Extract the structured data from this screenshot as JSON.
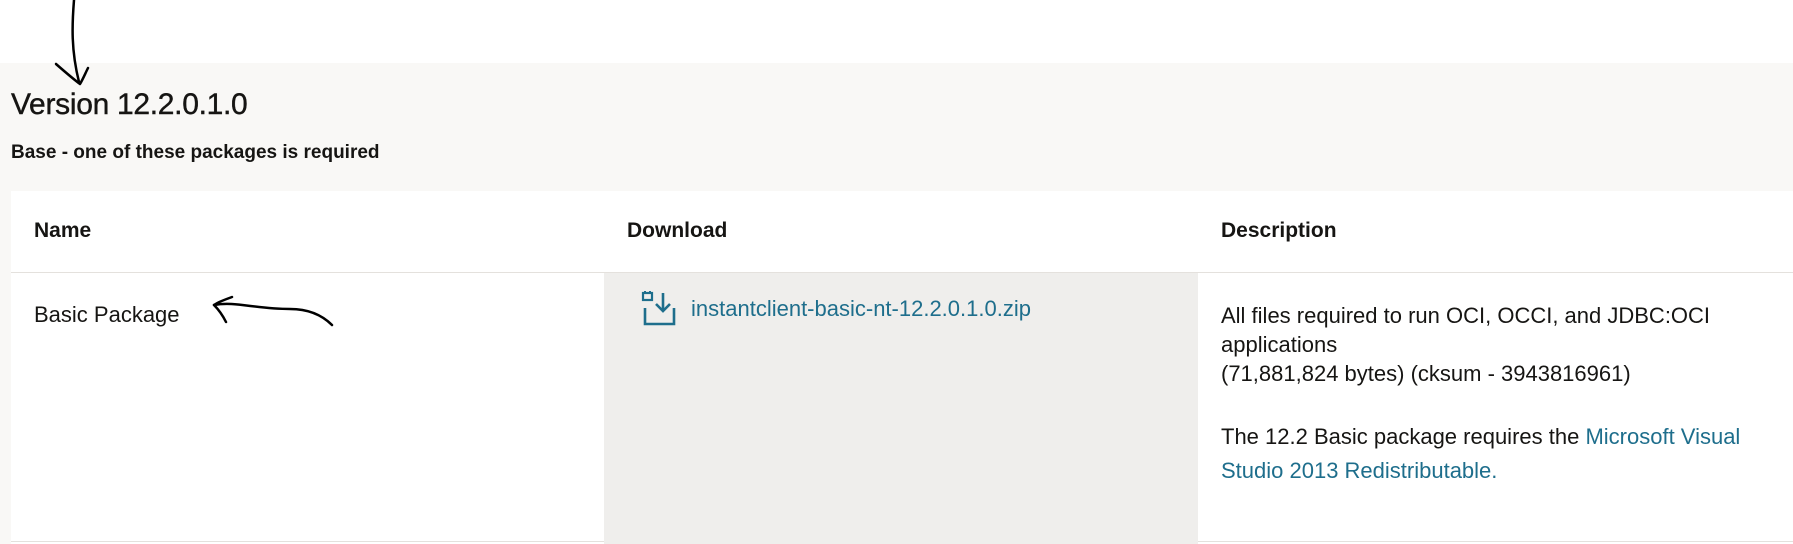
{
  "version_section": {
    "title": "Version 12.2.0.1.0",
    "subtitle": "Base - one of these packages is required"
  },
  "table": {
    "headers": {
      "name": "Name",
      "download": "Download",
      "description": "Description"
    },
    "rows": [
      {
        "name": "Basic Package",
        "download_icon": "download-icon",
        "download_filename": "instantclient-basic-nt-12.2.0.1.0.zip",
        "description_line1": "All files required to run OCI, OCCI, and JDBC:OCI applications",
        "description_line2": "(71,881,824 bytes) (cksum - 3943816961)",
        "note_prefix": "The 12.2 Basic package requires the ",
        "note_link": "Microsoft Visual Studio 2013 Redistributable."
      }
    ]
  },
  "colors": {
    "link": "#1e6e8c",
    "section_bg": "#f9f8f6",
    "download_cell_bg": "#efeeec",
    "text": "#161513"
  },
  "annotations": [
    "hand-drawn-down-arrow",
    "hand-drawn-left-arrow"
  ]
}
